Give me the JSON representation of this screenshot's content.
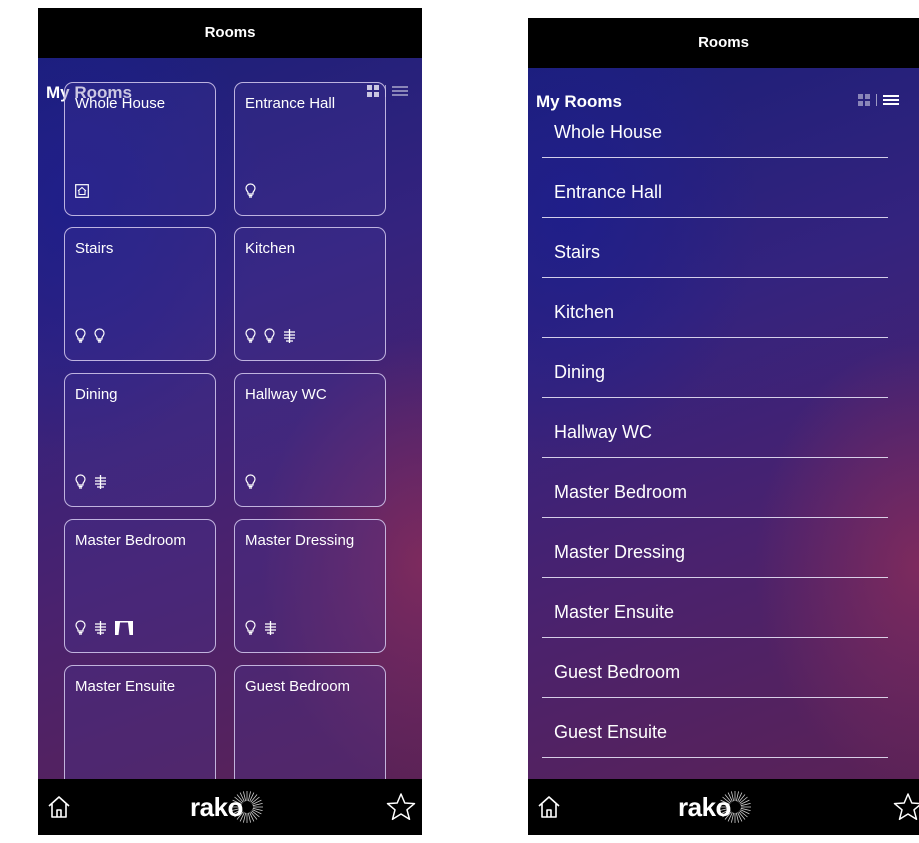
{
  "grid_view": {
    "title": "Rooms",
    "section_title": "My Rooms",
    "view_toggle": {
      "active": "grid"
    },
    "rooms": [
      {
        "name": "Whole House",
        "icons": [
          "house-icon"
        ]
      },
      {
        "name": "Entrance Hall",
        "icons": [
          "bulb-icon"
        ]
      },
      {
        "name": "Stairs",
        "icons": [
          "bulb-icon",
          "bulb-icon"
        ]
      },
      {
        "name": "Kitchen",
        "icons": [
          "bulb-icon",
          "bulb-icon",
          "blind-icon"
        ]
      },
      {
        "name": "Dining",
        "icons": [
          "bulb-icon",
          "blind-icon"
        ]
      },
      {
        "name": "Hallway WC",
        "icons": [
          "bulb-icon"
        ]
      },
      {
        "name": "Master Bedroom",
        "icons": [
          "bulb-icon",
          "blind-icon",
          "curtain-icon"
        ]
      },
      {
        "name": "Master Dressing",
        "icons": [
          "bulb-icon",
          "blind-icon"
        ]
      },
      {
        "name": "Master Ensuite",
        "icons": []
      },
      {
        "name": "Guest Bedroom",
        "icons": []
      }
    ],
    "bottom_bar": {
      "home": "home-icon",
      "logo": "rako",
      "favorite": "star-icon"
    }
  },
  "list_view": {
    "title": "Rooms",
    "section_title": "My Rooms",
    "view_toggle": {
      "active": "list"
    },
    "rooms": [
      "Whole House",
      "Entrance Hall",
      "Stairs",
      "Kitchen",
      "Dining",
      "Hallway WC",
      "Master Bedroom",
      "Master Dressing",
      "Master Ensuite",
      "Guest Bedroom",
      "Guest Ensuite"
    ],
    "bottom_bar": {
      "home": "home-icon",
      "logo": "rako",
      "favorite": "star-icon"
    }
  },
  "colors": {
    "accent_white": "#ffffff",
    "toggle_dim": "#8a86b8",
    "top_bar": "#000000"
  }
}
